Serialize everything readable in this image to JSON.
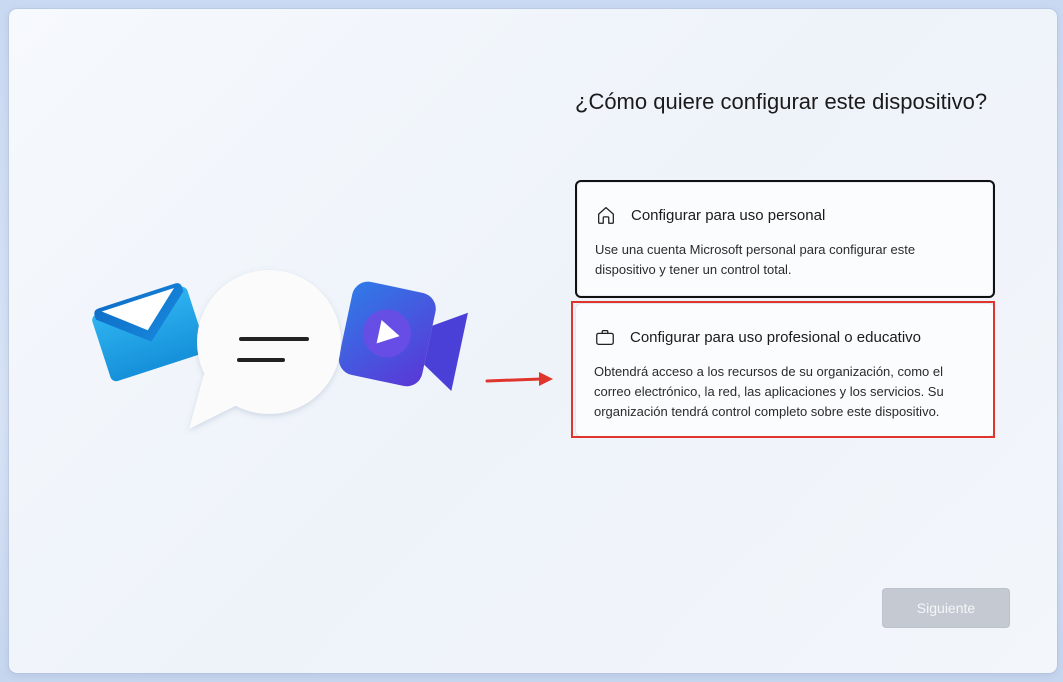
{
  "heading": "¿Cómo quiere configurar este dispositivo?",
  "options": [
    {
      "title": "Configurar para uso personal",
      "description": "Use una cuenta Microsoft personal para configurar este dispositivo y tener un control total.",
      "icon": "home-icon",
      "selected": true
    },
    {
      "title": "Configurar para uso profesional o educativo",
      "description": "Obtendrá acceso a los recursos de su organización, como el correo electrónico, la red, las aplicaciones y los servicios. Su organización tendrá control completo sobre este dispositivo.",
      "icon": "briefcase-icon",
      "selected": false,
      "highlighted": true
    }
  ],
  "footer": {
    "next_label": "Siguiente",
    "next_enabled": false
  },
  "colors": {
    "highlight": "#e0352c",
    "mail_blue": "#1f8fe0",
    "video_purple": "#5a3ae0"
  }
}
